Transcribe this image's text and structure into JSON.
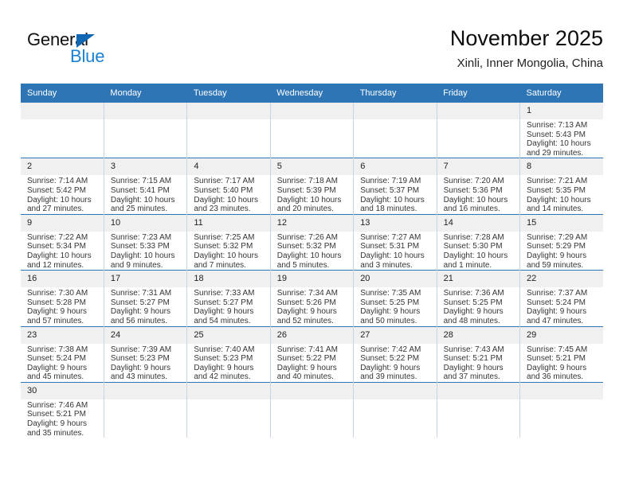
{
  "brand": {
    "name_top": "General",
    "name_bottom": "Blue",
    "triangle_color": "#1167b1",
    "blue_text_color": "#1b81d4"
  },
  "header": {
    "title": "November 2025",
    "subtitle": "Xinli, Inner Mongolia, China"
  },
  "theme": {
    "header_blue": "#2e75b6",
    "daynum_band": "#f0f0f0",
    "grid_line": "#c8d4e2"
  },
  "labels": {
    "sunrise_prefix": "Sunrise:",
    "sunset_prefix": "Sunset:",
    "daylight_prefix": "Daylight:"
  },
  "weekday_headers": [
    "Sunday",
    "Monday",
    "Tuesday",
    "Wednesday",
    "Thursday",
    "Friday",
    "Saturday"
  ],
  "weeks": [
    [
      {
        "day": "",
        "sunrise": "",
        "sunset": "",
        "daylight_line1": "",
        "daylight_line2": ""
      },
      {
        "day": "",
        "sunrise": "",
        "sunset": "",
        "daylight_line1": "",
        "daylight_line2": ""
      },
      {
        "day": "",
        "sunrise": "",
        "sunset": "",
        "daylight_line1": "",
        "daylight_line2": ""
      },
      {
        "day": "",
        "sunrise": "",
        "sunset": "",
        "daylight_line1": "",
        "daylight_line2": ""
      },
      {
        "day": "",
        "sunrise": "",
        "sunset": "",
        "daylight_line1": "",
        "daylight_line2": ""
      },
      {
        "day": "",
        "sunrise": "",
        "sunset": "",
        "daylight_line1": "",
        "daylight_line2": ""
      },
      {
        "day": "1",
        "sunrise": "Sunrise: 7:13 AM",
        "sunset": "Sunset: 5:43 PM",
        "daylight_line1": "Daylight: 10 hours",
        "daylight_line2": "and 29 minutes."
      }
    ],
    [
      {
        "day": "2",
        "sunrise": "Sunrise: 7:14 AM",
        "sunset": "Sunset: 5:42 PM",
        "daylight_line1": "Daylight: 10 hours",
        "daylight_line2": "and 27 minutes."
      },
      {
        "day": "3",
        "sunrise": "Sunrise: 7:15 AM",
        "sunset": "Sunset: 5:41 PM",
        "daylight_line1": "Daylight: 10 hours",
        "daylight_line2": "and 25 minutes."
      },
      {
        "day": "4",
        "sunrise": "Sunrise: 7:17 AM",
        "sunset": "Sunset: 5:40 PM",
        "daylight_line1": "Daylight: 10 hours",
        "daylight_line2": "and 23 minutes."
      },
      {
        "day": "5",
        "sunrise": "Sunrise: 7:18 AM",
        "sunset": "Sunset: 5:39 PM",
        "daylight_line1": "Daylight: 10 hours",
        "daylight_line2": "and 20 minutes."
      },
      {
        "day": "6",
        "sunrise": "Sunrise: 7:19 AM",
        "sunset": "Sunset: 5:37 PM",
        "daylight_line1": "Daylight: 10 hours",
        "daylight_line2": "and 18 minutes."
      },
      {
        "day": "7",
        "sunrise": "Sunrise: 7:20 AM",
        "sunset": "Sunset: 5:36 PM",
        "daylight_line1": "Daylight: 10 hours",
        "daylight_line2": "and 16 minutes."
      },
      {
        "day": "8",
        "sunrise": "Sunrise: 7:21 AM",
        "sunset": "Sunset: 5:35 PM",
        "daylight_line1": "Daylight: 10 hours",
        "daylight_line2": "and 14 minutes."
      }
    ],
    [
      {
        "day": "9",
        "sunrise": "Sunrise: 7:22 AM",
        "sunset": "Sunset: 5:34 PM",
        "daylight_line1": "Daylight: 10 hours",
        "daylight_line2": "and 12 minutes."
      },
      {
        "day": "10",
        "sunrise": "Sunrise: 7:23 AM",
        "sunset": "Sunset: 5:33 PM",
        "daylight_line1": "Daylight: 10 hours",
        "daylight_line2": "and 9 minutes."
      },
      {
        "day": "11",
        "sunrise": "Sunrise: 7:25 AM",
        "sunset": "Sunset: 5:32 PM",
        "daylight_line1": "Daylight: 10 hours",
        "daylight_line2": "and 7 minutes."
      },
      {
        "day": "12",
        "sunrise": "Sunrise: 7:26 AM",
        "sunset": "Sunset: 5:32 PM",
        "daylight_line1": "Daylight: 10 hours",
        "daylight_line2": "and 5 minutes."
      },
      {
        "day": "13",
        "sunrise": "Sunrise: 7:27 AM",
        "sunset": "Sunset: 5:31 PM",
        "daylight_line1": "Daylight: 10 hours",
        "daylight_line2": "and 3 minutes."
      },
      {
        "day": "14",
        "sunrise": "Sunrise: 7:28 AM",
        "sunset": "Sunset: 5:30 PM",
        "daylight_line1": "Daylight: 10 hours",
        "daylight_line2": "and 1 minute."
      },
      {
        "day": "15",
        "sunrise": "Sunrise: 7:29 AM",
        "sunset": "Sunset: 5:29 PM",
        "daylight_line1": "Daylight: 9 hours",
        "daylight_line2": "and 59 minutes."
      }
    ],
    [
      {
        "day": "16",
        "sunrise": "Sunrise: 7:30 AM",
        "sunset": "Sunset: 5:28 PM",
        "daylight_line1": "Daylight: 9 hours",
        "daylight_line2": "and 57 minutes."
      },
      {
        "day": "17",
        "sunrise": "Sunrise: 7:31 AM",
        "sunset": "Sunset: 5:27 PM",
        "daylight_line1": "Daylight: 9 hours",
        "daylight_line2": "and 56 minutes."
      },
      {
        "day": "18",
        "sunrise": "Sunrise: 7:33 AM",
        "sunset": "Sunset: 5:27 PM",
        "daylight_line1": "Daylight: 9 hours",
        "daylight_line2": "and 54 minutes."
      },
      {
        "day": "19",
        "sunrise": "Sunrise: 7:34 AM",
        "sunset": "Sunset: 5:26 PM",
        "daylight_line1": "Daylight: 9 hours",
        "daylight_line2": "and 52 minutes."
      },
      {
        "day": "20",
        "sunrise": "Sunrise: 7:35 AM",
        "sunset": "Sunset: 5:25 PM",
        "daylight_line1": "Daylight: 9 hours",
        "daylight_line2": "and 50 minutes."
      },
      {
        "day": "21",
        "sunrise": "Sunrise: 7:36 AM",
        "sunset": "Sunset: 5:25 PM",
        "daylight_line1": "Daylight: 9 hours",
        "daylight_line2": "and 48 minutes."
      },
      {
        "day": "22",
        "sunrise": "Sunrise: 7:37 AM",
        "sunset": "Sunset: 5:24 PM",
        "daylight_line1": "Daylight: 9 hours",
        "daylight_line2": "and 47 minutes."
      }
    ],
    [
      {
        "day": "23",
        "sunrise": "Sunrise: 7:38 AM",
        "sunset": "Sunset: 5:24 PM",
        "daylight_line1": "Daylight: 9 hours",
        "daylight_line2": "and 45 minutes."
      },
      {
        "day": "24",
        "sunrise": "Sunrise: 7:39 AM",
        "sunset": "Sunset: 5:23 PM",
        "daylight_line1": "Daylight: 9 hours",
        "daylight_line2": "and 43 minutes."
      },
      {
        "day": "25",
        "sunrise": "Sunrise: 7:40 AM",
        "sunset": "Sunset: 5:23 PM",
        "daylight_line1": "Daylight: 9 hours",
        "daylight_line2": "and 42 minutes."
      },
      {
        "day": "26",
        "sunrise": "Sunrise: 7:41 AM",
        "sunset": "Sunset: 5:22 PM",
        "daylight_line1": "Daylight: 9 hours",
        "daylight_line2": "and 40 minutes."
      },
      {
        "day": "27",
        "sunrise": "Sunrise: 7:42 AM",
        "sunset": "Sunset: 5:22 PM",
        "daylight_line1": "Daylight: 9 hours",
        "daylight_line2": "and 39 minutes."
      },
      {
        "day": "28",
        "sunrise": "Sunrise: 7:43 AM",
        "sunset": "Sunset: 5:21 PM",
        "daylight_line1": "Daylight: 9 hours",
        "daylight_line2": "and 37 minutes."
      },
      {
        "day": "29",
        "sunrise": "Sunrise: 7:45 AM",
        "sunset": "Sunset: 5:21 PM",
        "daylight_line1": "Daylight: 9 hours",
        "daylight_line2": "and 36 minutes."
      }
    ],
    [
      {
        "day": "30",
        "sunrise": "Sunrise: 7:46 AM",
        "sunset": "Sunset: 5:21 PM",
        "daylight_line1": "Daylight: 9 hours",
        "daylight_line2": "and 35 minutes."
      },
      {
        "day": "",
        "sunrise": "",
        "sunset": "",
        "daylight_line1": "",
        "daylight_line2": ""
      },
      {
        "day": "",
        "sunrise": "",
        "sunset": "",
        "daylight_line1": "",
        "daylight_line2": ""
      },
      {
        "day": "",
        "sunrise": "",
        "sunset": "",
        "daylight_line1": "",
        "daylight_line2": ""
      },
      {
        "day": "",
        "sunrise": "",
        "sunset": "",
        "daylight_line1": "",
        "daylight_line2": ""
      },
      {
        "day": "",
        "sunrise": "",
        "sunset": "",
        "daylight_line1": "",
        "daylight_line2": ""
      },
      {
        "day": "",
        "sunrise": "",
        "sunset": "",
        "daylight_line1": "",
        "daylight_line2": ""
      }
    ]
  ]
}
